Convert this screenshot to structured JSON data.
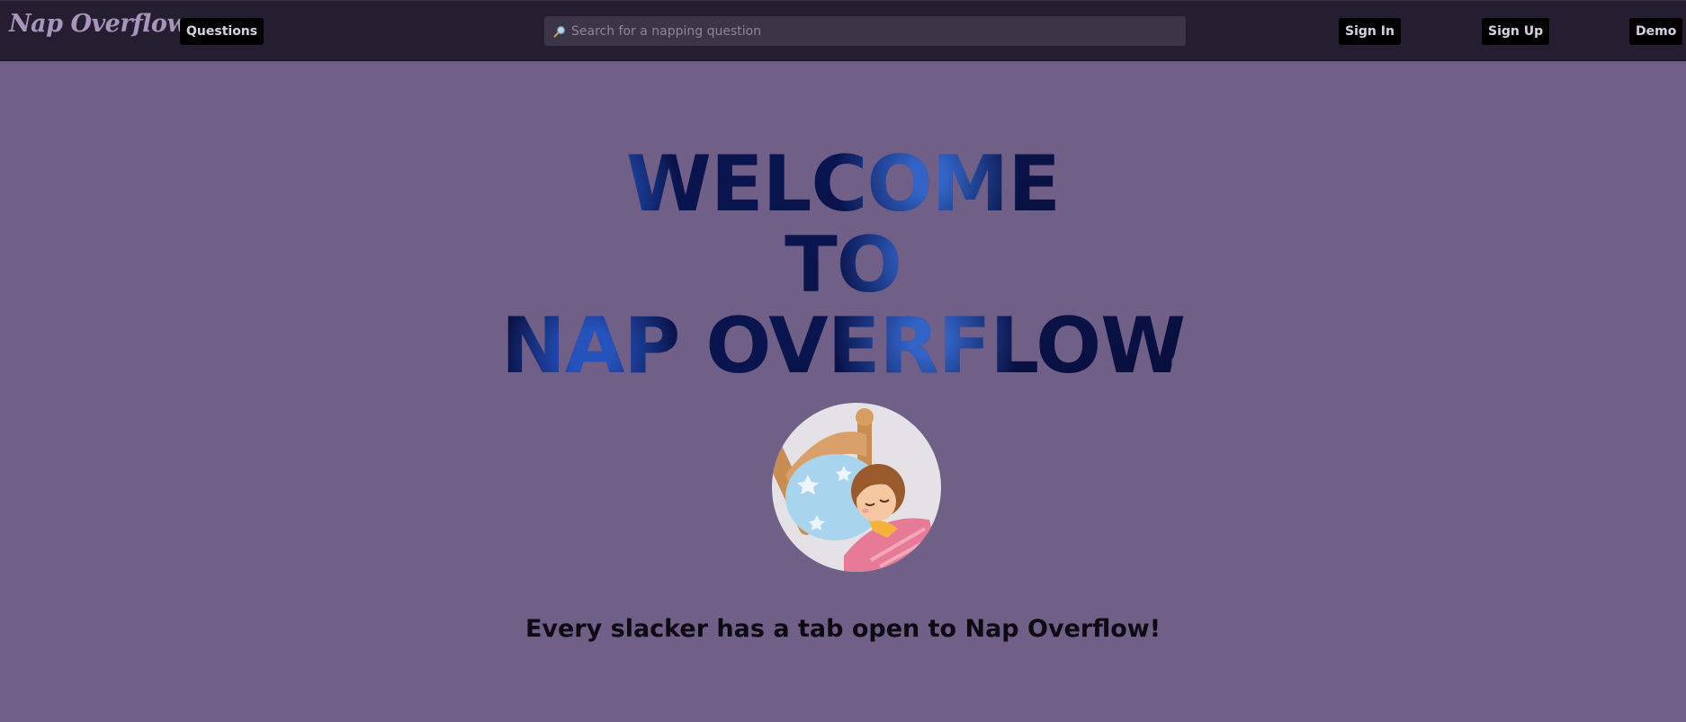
{
  "navbar": {
    "logo": "Nap Overflow",
    "questions_label": "Questions",
    "search_placeholder": "Search for a napping question",
    "sign_in_label": "Sign In",
    "sign_up_label": "Sign Up",
    "demo_label": "Demo"
  },
  "hero": {
    "line1": "WELCOME",
    "line2": "TO",
    "line3": "NAP OVERFLOW",
    "image_icon": "sleeping-child-illustration"
  },
  "tagline": "Every slacker has a tab open to Nap Overflow!",
  "colors": {
    "page_background": "#705f86",
    "navbar_background": "#251d30",
    "button_background": "#000000",
    "logo_color": "#a895bb"
  }
}
